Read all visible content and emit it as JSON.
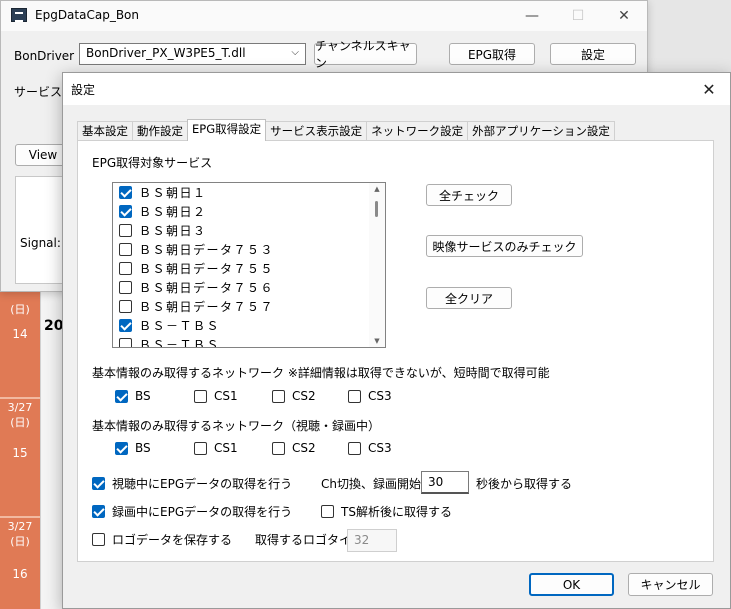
{
  "background": {
    "days": [
      {
        "date": "",
        "dow": "(日)",
        "hour": "14"
      },
      {
        "date": "3/27",
        "dow": "(日)",
        "hour": "15"
      },
      {
        "date": "3/27",
        "dow": "(日)",
        "hour": "16"
      }
    ],
    "col_label": "20"
  },
  "main_window": {
    "title": "EpgDataCap_Bon",
    "bondriver_label": "BonDriver",
    "bondriver_value": "BonDriver_PX_W3PE5_T.dll",
    "channel_scan_label": "チャンネルスキャン",
    "epg_get_label": "EPG取得",
    "settings_label": "設定",
    "service_label": "サービス",
    "view_label": "View",
    "signal_label": "Signal:"
  },
  "dialog": {
    "title": "設定",
    "tabs": [
      {
        "label": "基本設定",
        "active": false
      },
      {
        "label": "動作設定",
        "active": false
      },
      {
        "label": "EPG取得設定",
        "active": true
      },
      {
        "label": "サービス表示設定",
        "active": false
      },
      {
        "label": "ネットワーク設定",
        "active": false
      },
      {
        "label": "外部アプリケーション設定",
        "active": false
      }
    ],
    "services_header": "EPG取得対象サービス",
    "services": [
      {
        "label": "ＢＳ朝日１",
        "checked": true
      },
      {
        "label": "ＢＳ朝日２",
        "checked": true
      },
      {
        "label": "ＢＳ朝日３",
        "checked": false
      },
      {
        "label": "ＢＳ朝日データ７５３",
        "checked": false
      },
      {
        "label": "ＢＳ朝日データ７５５",
        "checked": false
      },
      {
        "label": "ＢＳ朝日データ７５６",
        "checked": false
      },
      {
        "label": "ＢＳ朝日データ７５７",
        "checked": false
      },
      {
        "label": "ＢＳ－ＴＢＳ",
        "checked": true
      },
      {
        "label": "ＢＳ－ＴＢＳ",
        "checked": false
      }
    ],
    "check_all_label": "全チェック",
    "check_video_only_label": "映像サービスのみチェック",
    "clear_all_label": "全クリア",
    "basic_network_label": "基本情報のみ取得するネットワーク ※詳細情報は取得できないが、短時間で取得可能",
    "basic_network": [
      {
        "label": "BS",
        "checked": true
      },
      {
        "label": "CS1",
        "checked": false
      },
      {
        "label": "CS2",
        "checked": false
      },
      {
        "label": "CS3",
        "checked": false
      }
    ],
    "basic_network_rec_label": "基本情報のみ取得するネットワーク（視聴・録画中）",
    "basic_network_rec": [
      {
        "label": "BS",
        "checked": true
      },
      {
        "label": "CS1",
        "checked": false
      },
      {
        "label": "CS2",
        "checked": false
      },
      {
        "label": "CS3",
        "checked": false
      }
    ],
    "view_epg_label": "視聴中にEPGデータの取得を行う",
    "view_epg_checked": true,
    "rec_epg_label": "録画中にEPGデータの取得を行う",
    "rec_epg_checked": true,
    "ch_change_label": "Ch切換、録画開始",
    "ch_change_value": "30",
    "after_seconds_label": "秒後から取得する",
    "ts_analysis_label": "TS解析後に取得する",
    "ts_analysis_checked": false,
    "save_logo_label": "ロゴデータを保存する",
    "save_logo_checked": false,
    "logo_type_label": "取得するロゴタイプ",
    "logo_type_value": "32",
    "ok_label": "OK",
    "cancel_label": "キャンセル"
  }
}
